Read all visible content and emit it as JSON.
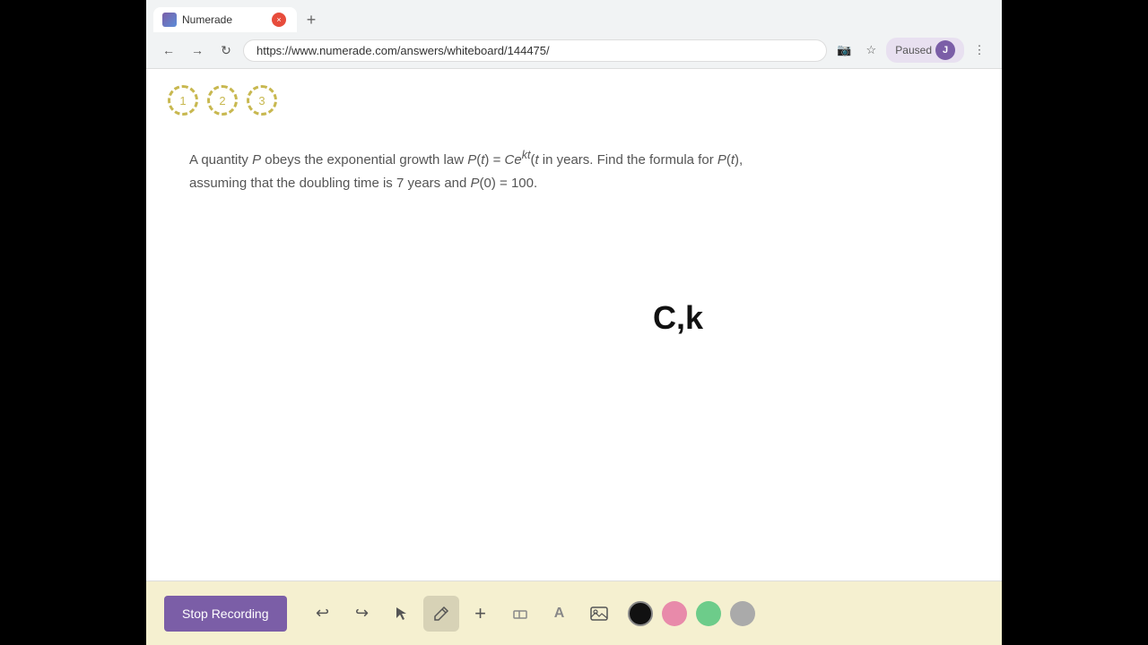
{
  "browser": {
    "tab": {
      "favicon_label": "N",
      "title": "Numerade",
      "close_label": "×",
      "add_label": "+"
    },
    "nav": {
      "back_label": "←",
      "forward_label": "→",
      "refresh_label": "↻",
      "url": "https://www.numerade.com/answers/whiteboard/144475/",
      "camera_label": "📷",
      "star_label": "☆",
      "paused_label": "Paused",
      "more_label": "⋮"
    }
  },
  "page": {
    "steps": [
      {
        "number": "1"
      },
      {
        "number": "2"
      },
      {
        "number": "3"
      }
    ],
    "problem": {
      "line1": "A quantity P obeys the exponential growth law P(t) = Ce",
      "superscript": "kt",
      "line1_end": "(t in years. Find the formula for P(t),",
      "line2": "assuming that the doubling time is 7 years and P(0) = 100."
    },
    "annotation": "C,k"
  },
  "toolbar": {
    "stop_recording_label": "Stop Recording",
    "tools": [
      {
        "name": "undo",
        "symbol": "↩"
      },
      {
        "name": "redo",
        "symbol": "↪"
      },
      {
        "name": "select",
        "symbol": "▲"
      },
      {
        "name": "pen",
        "symbol": "✏"
      },
      {
        "name": "plus",
        "symbol": "+"
      },
      {
        "name": "eraser",
        "symbol": "◫"
      },
      {
        "name": "text",
        "symbol": "A"
      },
      {
        "name": "image",
        "symbol": "🖼"
      }
    ],
    "colors": [
      {
        "name": "black",
        "hex": "#111111"
      },
      {
        "name": "pink",
        "hex": "#e88aaa"
      },
      {
        "name": "green",
        "hex": "#6dcc8a"
      },
      {
        "name": "gray",
        "hex": "#aaaaaa"
      }
    ]
  }
}
